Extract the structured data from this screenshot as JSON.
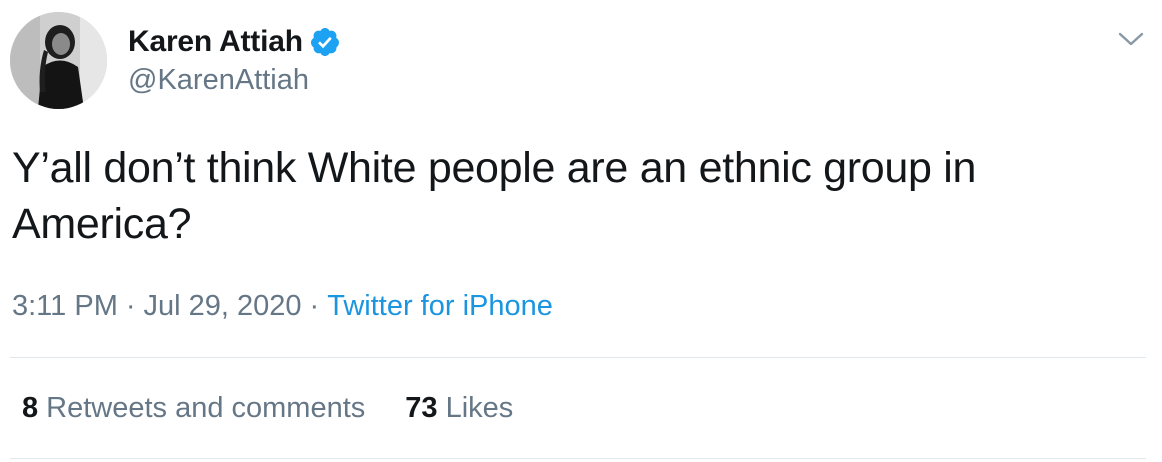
{
  "author": {
    "display_name": "Karen Attiah",
    "handle": "@KarenAttiah",
    "verified": true,
    "avatar_icon": "profile-photo"
  },
  "tweet": {
    "text": "Y’all don’t think White people are an ethnic group in America?",
    "time": "3:11 PM",
    "date": "Jul 29, 2020",
    "separator": "·",
    "source": "Twitter for iPhone"
  },
  "stats": {
    "retweets_count": "8",
    "retweets_label": "Retweets and comments",
    "likes_count": "73",
    "likes_label": "Likes"
  },
  "colors": {
    "text": "#14171a",
    "secondary": "#657786",
    "link": "#1b95e0",
    "verified": "#1da1f2",
    "divider": "#e1e8ed"
  },
  "icons": {
    "verified": "verified-badge-icon",
    "menu": "chevron-down-icon"
  }
}
